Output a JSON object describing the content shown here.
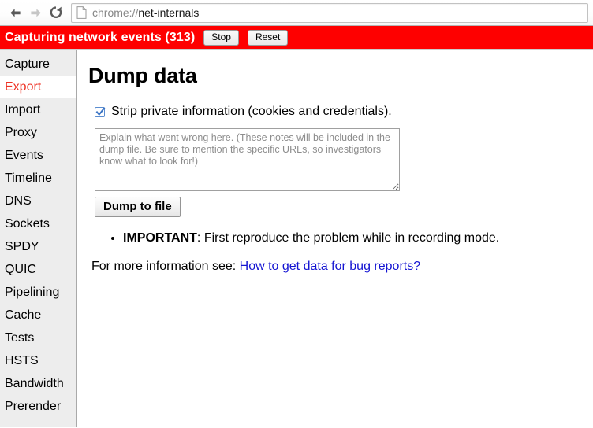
{
  "browser": {
    "back_icon": "back-arrow-icon",
    "forward_icon": "forward-arrow-icon",
    "reload_icon": "reload-icon",
    "page_icon": "page-document-icon",
    "url_scheme": "chrome://",
    "url_host": "net-internals",
    "url_full": "chrome://net-internals"
  },
  "status_banner": {
    "text": "Capturing network events (313)",
    "event_count": "313",
    "stop_label": "Stop",
    "reset_label": "Reset",
    "background_color": "#fe0000",
    "text_color": "#ffffff"
  },
  "sidebar": {
    "selected": "Export",
    "selected_color": "#ee3224",
    "background_color": "#ededed",
    "items": [
      {
        "label": "Capture"
      },
      {
        "label": "Export"
      },
      {
        "label": "Import"
      },
      {
        "label": "Proxy"
      },
      {
        "label": "Events"
      },
      {
        "label": "Timeline"
      },
      {
        "label": "DNS"
      },
      {
        "label": "Sockets"
      },
      {
        "label": "SPDY"
      },
      {
        "label": "QUIC"
      },
      {
        "label": "Pipelining"
      },
      {
        "label": "Cache"
      },
      {
        "label": "Tests"
      },
      {
        "label": "HSTS"
      },
      {
        "label": "Bandwidth"
      },
      {
        "label": "Prerender"
      }
    ]
  },
  "main": {
    "heading": "Dump data",
    "strip_private_checkbox": {
      "label": "Strip private information (cookies and credentials).",
      "checked": true,
      "accent_color": "#5b8dd0"
    },
    "notes": {
      "value": "",
      "placeholder": "Explain what went wrong here. (These notes will be included in the dump file. Be sure to mention the specific URLs, so investigators know what to look for!)"
    },
    "dump_button_label": "Dump to file",
    "important_bullet": {
      "strong": "IMPORTANT",
      "rest": ": First reproduce the problem while in recording mode."
    },
    "more_info": {
      "prefix": "For more information see:",
      "link_text": "How to get data for bug reports?",
      "link_color": "#1414d2"
    }
  }
}
